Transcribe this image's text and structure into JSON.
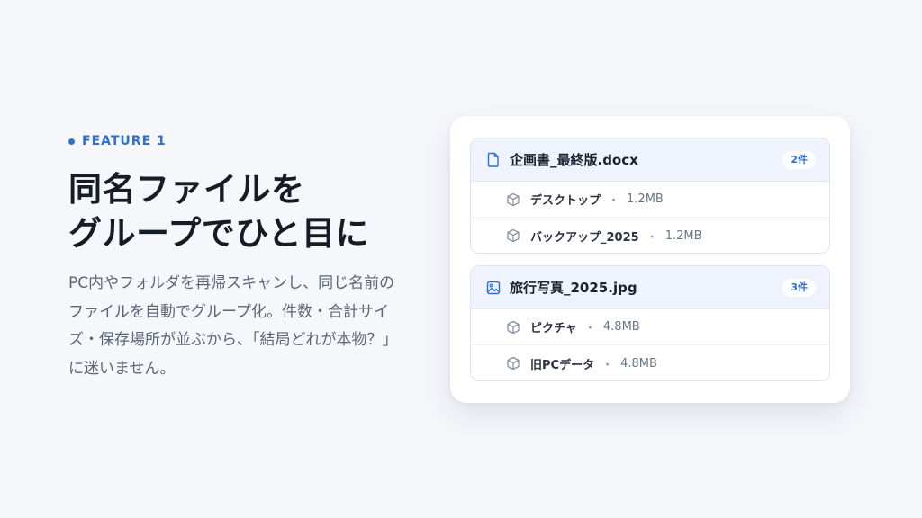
{
  "feature": {
    "eyebrow": "FEATURE 1",
    "headline_line1": "同名ファイルを",
    "headline_line2": "グループでひと目に",
    "description": "PC内やフォルダを再帰スキャンし、同じ名前のファイルを自動でグループ化。件数・合計サイズ・保存場所が並ぶから、「結局どれが本物？」に迷いません。"
  },
  "colors": {
    "accent": "#2f6fd3",
    "background": "#f5f7fb",
    "group_header": "#eef3fd"
  },
  "groups": [
    {
      "file_name": "企画書_最終版.docx",
      "icon": "document-icon",
      "count": "2件",
      "locations": [
        {
          "name": "デスクトップ",
          "sep": "・",
          "size": "1.2MB"
        },
        {
          "name": "バックアップ_2025",
          "sep": "・",
          "size": "1.2MB"
        }
      ]
    },
    {
      "file_name": "旅行写真_2025.jpg",
      "icon": "image-icon",
      "count": "3件",
      "locations": [
        {
          "name": "ピクチャ",
          "sep": "・",
          "size": "4.8MB"
        },
        {
          "name": "旧PCデータ",
          "sep": "・",
          "size": "4.8MB"
        }
      ]
    }
  ]
}
